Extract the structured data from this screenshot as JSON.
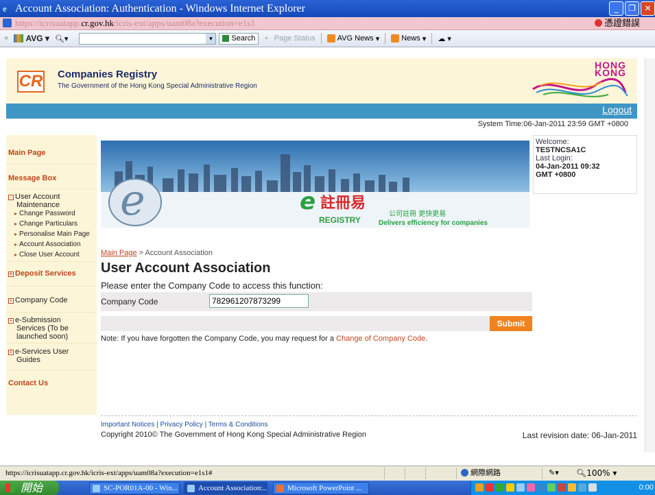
{
  "window": {
    "title": "Account Association: Authentication - Windows Internet Explorer",
    "url_prefix": "https://icrisuatapp.",
    "url_domain": "cr.gov.hk",
    "url_suffix": "/icris-ext/apps/uam08a?execution=e1s1",
    "cert_error": "憑證錯誤"
  },
  "toolbar": {
    "avg": "AVG",
    "search_label": "Search",
    "page_status": "Page Status",
    "avg_news": "AVG News",
    "news": "News"
  },
  "header": {
    "org_name": "Companies Registry",
    "org_sub": "The Government of the Hong Kong Special Administrative Region",
    "logo_text": "CR",
    "hk_brand_1": "HONG",
    "hk_brand_2": "KONG",
    "logout": "Logout",
    "system_time": "System Time:06-Jan-2011 23:59 GMT +0800"
  },
  "sidebar": {
    "main_page": "Main Page",
    "message_box": "Message Box",
    "user_account_1": "User Account",
    "user_account_2": "Maintenance",
    "sub_items": [
      "Change Password",
      "Change Particulars",
      "Personalise Main Page",
      "Account Association",
      "Close User Account"
    ],
    "deposit_services": "Deposit Services",
    "company_code": "Company Code",
    "esub_1": "e-Submission",
    "esub_2": "Services (To be",
    "esub_3": "launched soon)",
    "eguides_1": "e-Services User",
    "eguides_2": "Guides",
    "contact_us": "Contact Us"
  },
  "banner": {
    "logo_cn": "註冊易",
    "logo_en": "REGISTRY",
    "tagline_cn": "公司註冊 更快更易",
    "tagline_en": "Delivers efficiency for companies"
  },
  "welcome": {
    "label": "Welcome:",
    "user": "TESTNCSA1C",
    "last_login_label": "Last Login:",
    "last_login_date": "04-Jan-2011 09:32",
    "last_login_tz": "GMT +0800"
  },
  "main": {
    "breadcrumb_home": "Main Page",
    "breadcrumb_sep": ">",
    "breadcrumb_current": "Account Association",
    "title": "User Account Association",
    "instruction": "Please enter the Company Code to access this function:",
    "field_label": "Company Code",
    "field_value": "782961207873299",
    "submit": "Submit",
    "note_prefix": "Note: If you have forgotten the Company Code, you may request for a ",
    "note_link": "Change of Company Code",
    "note_suffix": "."
  },
  "footer": {
    "link_1": "Important Notices",
    "link_2": "Privacy Policy",
    "link_3": "Terms & Conditions",
    "sep": "|",
    "copyright": "Copyright 2010© The Government of Hong Kong Special Administrative Region",
    "revision": "Last revision date: 06-Jan-2011"
  },
  "statusbar": {
    "url": "https://icrisuatapp.cr.gov.hk/icris-ext/apps/uam08a?execution=e1s1#",
    "zone": "網際網路",
    "zoom": "100%"
  },
  "taskbar": {
    "start": "開始",
    "tasks": [
      "SC-POR01A-00 - Win...",
      "Account Association:...",
      "Microsoft PowerPoint ..."
    ],
    "clock": "0:00"
  }
}
